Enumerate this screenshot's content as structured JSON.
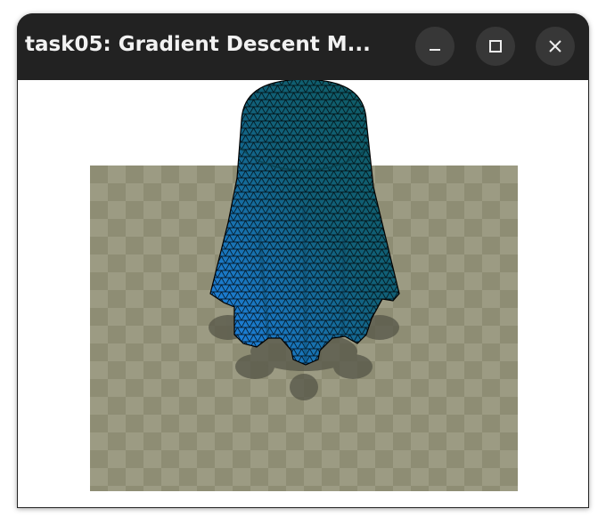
{
  "window": {
    "title": "task05: Gradient Descent M...",
    "buttons": {
      "minimize": "minimize-icon",
      "maximize": "maximize-icon",
      "close": "close-icon"
    }
  },
  "scene": {
    "floor_colors": [
      "#8e8d74",
      "#9c9b83"
    ],
    "cloth_colors": [
      "#1f86f0",
      "#0e5a60"
    ],
    "shadow_color": "#555547"
  }
}
